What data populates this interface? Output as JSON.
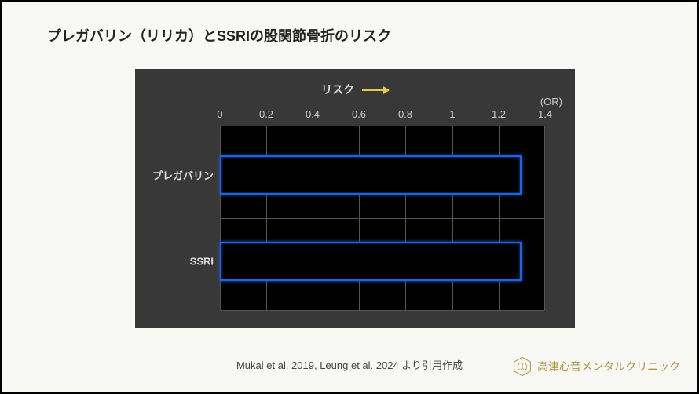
{
  "title": "プレガバリン（リリカ）とSSRIの股関節骨折のリスク",
  "chart": {
    "risk_label": "リスク",
    "or_label": "(OR)",
    "ticks": [
      "0",
      "0.2",
      "0.4",
      "0.6",
      "0.8",
      "1",
      "1.2",
      "1.4"
    ],
    "categories": [
      "プレガバリン",
      "SSRI"
    ]
  },
  "citation": "Mukai et al. 2019, Leung et al. 2024 より引用作成",
  "clinic_name": "高津心音メンタルクリニック",
  "chart_data": {
    "type": "bar",
    "orientation": "horizontal",
    "categories": [
      "プレガバリン",
      "SSRI"
    ],
    "values": [
      1.3,
      1.3
    ],
    "xlabel": "リスク (OR)",
    "ylabel": "",
    "xlim": [
      0,
      1.4
    ],
    "title": "プレガバリン（リリカ）とSSRIの股関節骨折のリスク"
  }
}
